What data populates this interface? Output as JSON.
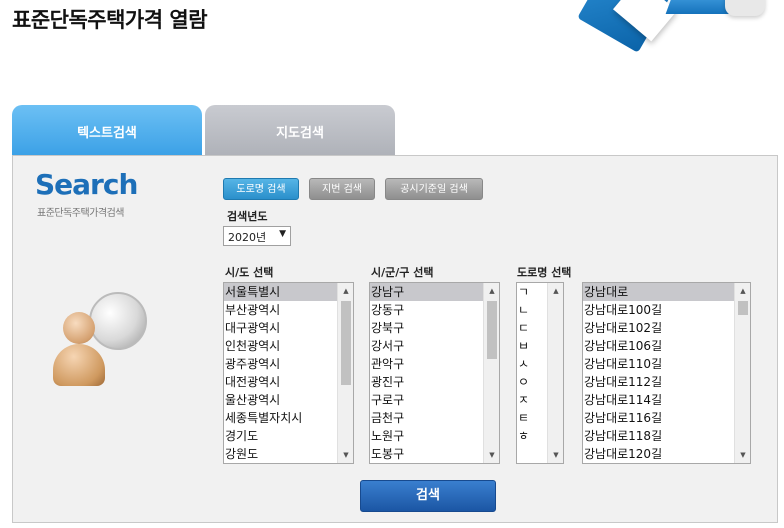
{
  "page": {
    "title": "표준단독주택가격 열람"
  },
  "tabs": [
    {
      "label": "텍스트검색",
      "active": true
    },
    {
      "label": "지도검색",
      "active": false
    }
  ],
  "branding": {
    "logo": "Search",
    "subtitle": "표준단독주택가격검색"
  },
  "search_modes": {
    "road": "도로명 검색",
    "lot": "지번 검색",
    "date": "공시기준일 검색"
  },
  "year": {
    "label": "검색년도",
    "selected": "2020년",
    "arrow": "▼"
  },
  "lists": {
    "sido": {
      "label": "시/도 선택",
      "items": [
        "서울특별시",
        "부산광역시",
        "대구광역시",
        "인천광역시",
        "광주광역시",
        "대전광역시",
        "울산광역시",
        "세종특별자치시",
        "경기도",
        "강원도"
      ]
    },
    "sigungu": {
      "label": "시/군/구 선택",
      "items": [
        "강남구",
        "강동구",
        "강북구",
        "강서구",
        "관악구",
        "광진구",
        "구로구",
        "금천구",
        "노원구",
        "도봉구"
      ]
    },
    "initial": {
      "label": "도로명 선택",
      "items": [
        "ㄱ",
        "ㄴ",
        "ㄷ",
        "ㅂ",
        "ㅅ",
        "ㅇ",
        "ㅈ",
        "ㅌ",
        "ㅎ"
      ]
    },
    "road": {
      "items": [
        "강남대로",
        "강남대로100길",
        "강남대로102길",
        "강남대로106길",
        "강남대로110길",
        "강남대로112길",
        "강남대로114길",
        "강남대로116길",
        "강남대로118길",
        "강남대로120길"
      ]
    }
  },
  "scroll_arrows": {
    "up": "▲",
    "down": "▼"
  },
  "actions": {
    "search": "검색"
  },
  "colors": {
    "tab_active": "#3aa0e6",
    "tab_inactive": "#aeb1b8",
    "primary_button": "#1b56a4",
    "brand": "#1d6fb8"
  }
}
